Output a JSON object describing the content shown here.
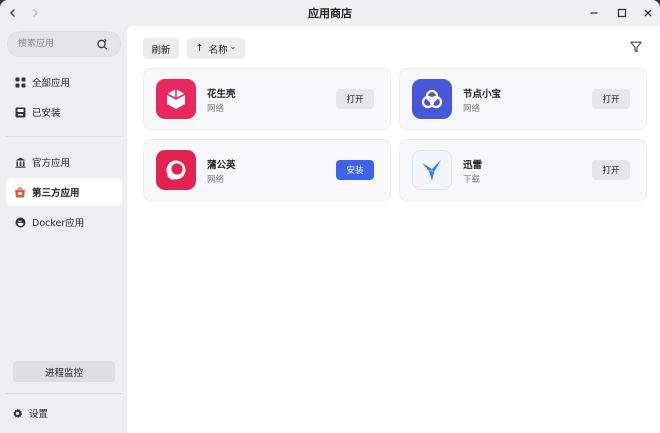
{
  "window": {
    "title": "应用商店",
    "back_icon": "chevron-left-icon",
    "forward_icon": "chevron-right-icon"
  },
  "sidebar": {
    "search_placeholder": "搜索应用",
    "items": [
      {
        "label": "全部应用",
        "icon": "grid-icon",
        "active": false
      },
      {
        "label": "已安装",
        "icon": "installed-icon",
        "active": false
      },
      {
        "label": "官方应用",
        "icon": "bank-icon",
        "active": false
      },
      {
        "label": "第三方应用",
        "icon": "store-icon",
        "active": true
      },
      {
        "label": "Docker应用",
        "icon": "docker-icon",
        "active": false
      }
    ],
    "monitor_label": "进程监控",
    "settings_label": "设置"
  },
  "toolbar": {
    "refresh_label": "刷新",
    "sort_label": "名称",
    "sort_arrow": "↑",
    "sort_caret": "⌄"
  },
  "apps": [
    {
      "name": "花生壳",
      "category": "网络",
      "action": "打开",
      "primary": false,
      "icon": "peanut-shell-icon",
      "color": "#e8265f"
    },
    {
      "name": "节点小宝",
      "category": "网络",
      "action": "打开",
      "primary": false,
      "icon": "node-icon",
      "color": "#4a56d8"
    },
    {
      "name": "蒲公英",
      "category": "网络",
      "action": "安装",
      "primary": true,
      "icon": "dandelion-icon",
      "color": "#e3234f"
    },
    {
      "name": "迅雷",
      "category": "下载",
      "action": "打开",
      "primary": false,
      "icon": "thunder-icon",
      "color": "#2b7de9"
    }
  ],
  "colors": {
    "accent": "#3d63e8",
    "sidebar_bg": "#efeff2",
    "content_bg": "#ffffff"
  }
}
